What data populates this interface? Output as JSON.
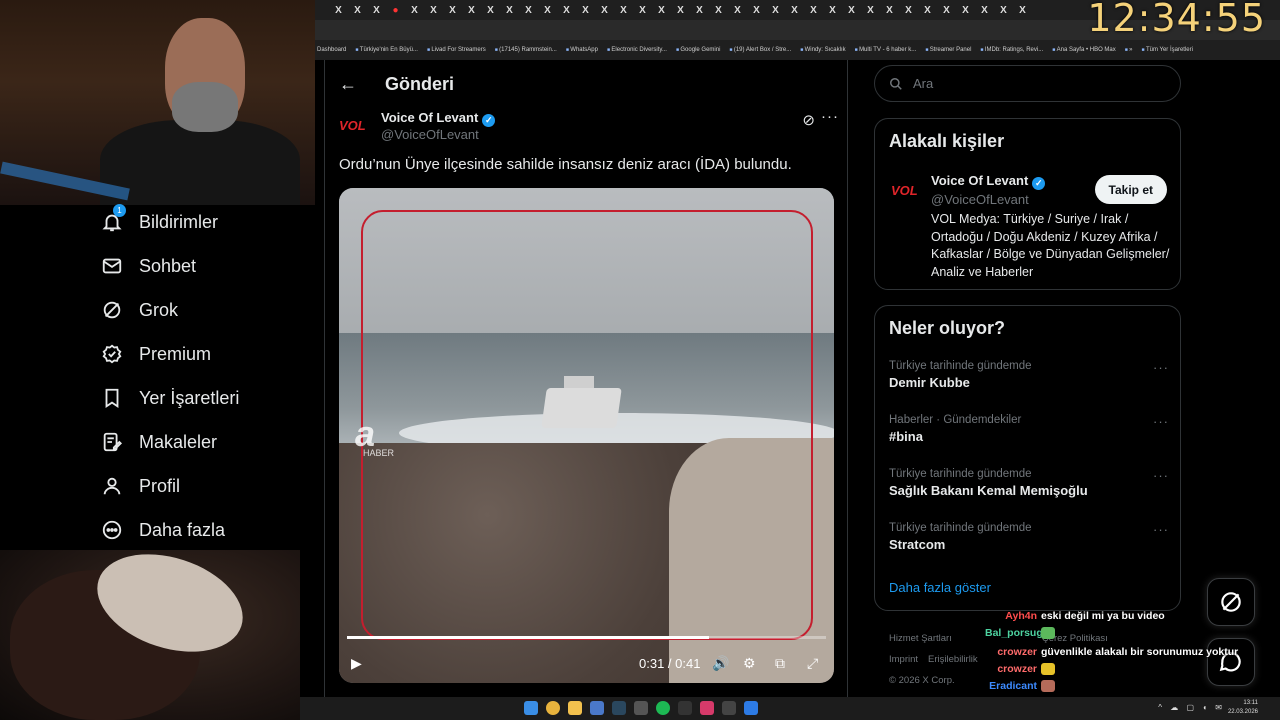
{
  "browser": {
    "tab_glyph": "X",
    "clock": "12:34:55",
    "bookmarks": [
      "Dashboard",
      "Türkiye'nin En Büyü...",
      "Livad For Streamers",
      "(17145) Rammstein...",
      "WhatsApp",
      "Electronic Diversity...",
      "Google Gemini",
      "(19) Alert Box / Stre...",
      "Windy: Sıcaklık",
      "Multi TV - 6 haber k...",
      "Streamer Panel",
      "IMDb: Ratings, Revi...",
      "Ana Sayfa • HBO Max",
      "»",
      "Tüm Yer İşaretleri"
    ]
  },
  "sidebar": {
    "notification_count": "1",
    "items": [
      {
        "label": "Bildirimler",
        "icon": "bell-icon"
      },
      {
        "label": "Sohbet",
        "icon": "mail-icon"
      },
      {
        "label": "Grok",
        "icon": "grok-icon"
      },
      {
        "label": "Premium",
        "icon": "premium-icon"
      },
      {
        "label": "Yer İşaretleri",
        "icon": "bookmark-icon"
      },
      {
        "label": "Makaleler",
        "icon": "article-icon"
      },
      {
        "label": "Profil",
        "icon": "profile-icon"
      },
      {
        "label": "Daha fazla",
        "icon": "more-icon"
      }
    ]
  },
  "post": {
    "header_title": "Gönderi",
    "author_logo": "VOL",
    "author_name": "Voice Of Levant",
    "author_handle": "@VoiceOfLevant",
    "text": "Ordu’nun Ünye ilçesinde sahilde insansız deniz aracı (İDA) bulundu.",
    "video": {
      "watermark": "a",
      "watermark_sub": "HABER",
      "current_time": "0:31",
      "duration": "0:41",
      "time_display": "0:31 / 0:41",
      "progress": 0.756
    }
  },
  "search": {
    "placeholder": "Ara"
  },
  "related": {
    "title": "Alakalı kişiler",
    "logo": "VOL",
    "name": "Voice Of Levant",
    "handle": "@VoiceOfLevant",
    "follow_label": "Takip et",
    "bio": "VOL Medya: Türkiye / Suriye / Irak / Ortadoğu / Doğu Akdeniz / Kuzey Afrika / Kafkaslar / Bölge ve Dünyadan Gelişmeler/ Analiz ve Haberler"
  },
  "trends": {
    "title": "Neler oluyor?",
    "items": [
      {
        "context": "Türkiye tarihinde gündemde",
        "topic": "Demir Kubbe"
      },
      {
        "context": "Haberler · Gündemdekiler",
        "topic": "#bina"
      },
      {
        "context": "Türkiye tarihinde gündemde",
        "topic": "Sağlık Bakanı Kemal Memişoğlu"
      },
      {
        "context": "Türkiye tarihinde gündemde",
        "topic": "Stratcom"
      }
    ],
    "show_more": "Daha fazla göster"
  },
  "footer": {
    "links": [
      "Hizmet Şartları",
      "Çerez Politikası",
      "Imprint",
      "Erişilebilirlik"
    ],
    "copyright": "© 2026 X Corp."
  },
  "chat": [
    {
      "user": "Ayh4n",
      "color": "#ff4d4d",
      "message": "eski değil mi ya bu video"
    },
    {
      "user": "Bal_porsugu",
      "color": "#4dd2a0",
      "message": ""
    },
    {
      "user": "crowzer",
      "color": "#ff6b6b",
      "message": "güvenlikle alakalı bir sorunumuz yoktur"
    },
    {
      "user": "crowzer",
      "color": "#ff6b6b",
      "message": ""
    },
    {
      "user": "Eradicant",
      "color": "#3d8bff",
      "message": ""
    },
    {
      "user": "Eradicant",
      "color": "#3d8bff",
      "message": ""
    }
  ],
  "taskbar": {
    "time": "13:11",
    "date": "22.03.2026"
  },
  "colors": {
    "accent": "#1d9bf0",
    "brand_red": "#e1252a",
    "clock": "#f5d27a"
  }
}
